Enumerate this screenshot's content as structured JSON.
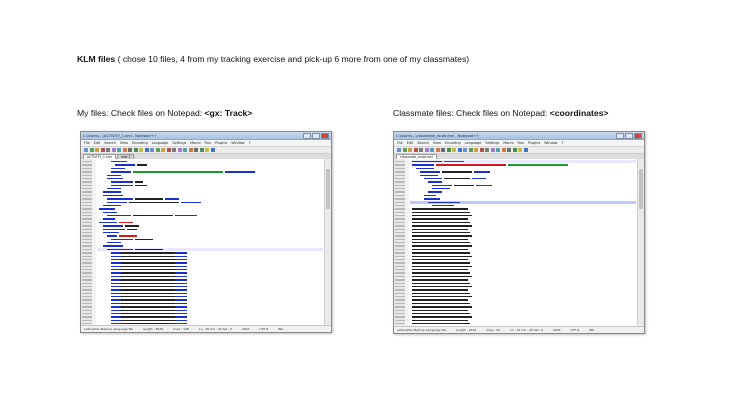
{
  "slide": {
    "heading_bold": "KLM files",
    "heading_rest": " ( chose 10 files, 4 from my tracking exercise and pick-up 6 more from one of my classmates)",
    "left_caption": "My files: Check files on Notepad:  ",
    "left_caption_bold": "<gx: Track>",
    "right_caption": "Classmate files: Check files on Notepad:  ",
    "right_caption_bold": "<coordinates>"
  },
  "menus": [
    "File",
    "Edit",
    "Search",
    "View",
    "Encoding",
    "Language",
    "Settings",
    "Macro",
    "Run",
    "Plugins",
    "Window",
    "?"
  ],
  "left_window": {
    "title": "C:\\Users\\...\\ACTIVITY_1.kml - Notepad++",
    "tabs": [
      "ACTIVITY_1.kml",
      "new 1"
    ],
    "status": [
      "eXtensible Markup Language file",
      "length : 8934",
      "lines : 148",
      "Ln : 36   Col : 32   Sel : 0",
      "UNIX",
      "UTF-8",
      "INS"
    ]
  },
  "right_window": {
    "title": "C:\\Users\\...\\classmate_route.kml - Notepad++",
    "tabs": [
      "classmate_route.kml"
    ],
    "status": [
      "eXtensible Markup Language file",
      "length : 2445",
      "lines : 62",
      "Ln : 14   Col : 28   Sel : 0",
      "UNIX",
      "UTF-8",
      "INS"
    ]
  },
  "colors": {
    "tag_blue": "#1a2fd0",
    "attr_red": "#d01a1a",
    "string_purple": "#8a1ad0",
    "text_black": "#222222",
    "link_green": "#1a9a2a"
  }
}
